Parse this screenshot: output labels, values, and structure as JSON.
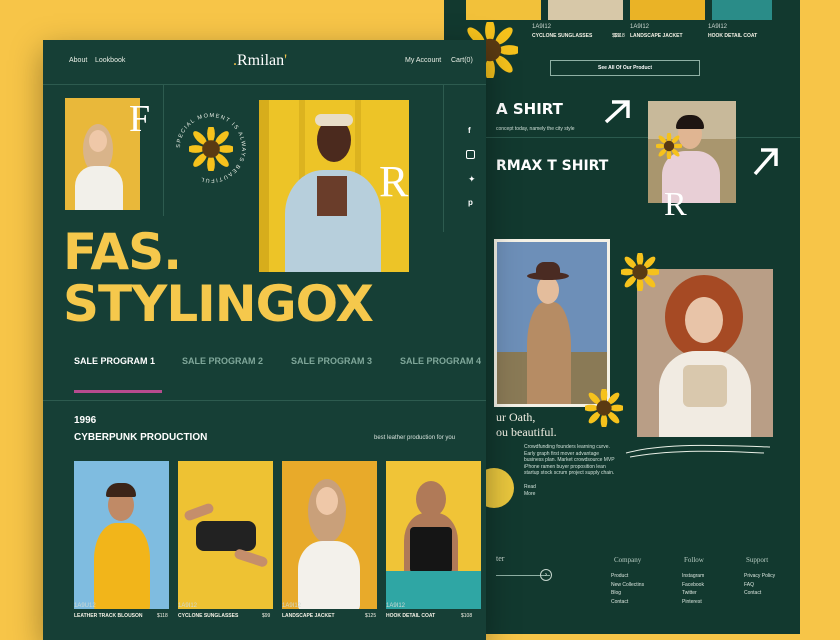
{
  "nav": {
    "about": "About",
    "lookbook": "Lookbook",
    "account": "My Account",
    "cart": "Cart(0)"
  },
  "logo": "Rmilan",
  "letters": {
    "f": "F",
    "r": "R",
    "r2": "R"
  },
  "circle_text": "SPECIAL MOMENT IS ALWAYS BEAUTIFUL",
  "hero": {
    "line1": "FAS.",
    "line2": "STYLINGOX"
  },
  "tabs": [
    "SALE PROGRAM 1",
    "SALE PROGRAM 2",
    "SALE PROGRAM 3",
    "SALE PROGRAM 4"
  ],
  "section": {
    "year": "1996",
    "title": "CYBERPUNK PRODUCTION",
    "tagline": "best leather production for you"
  },
  "products": [
    {
      "code": "1A9U12",
      "name": "LEATHER TRACK BLOUSON",
      "price": "$118"
    },
    {
      "code": "1A9I12",
      "name": "CYCLONE SUNGLASSES",
      "price": "$99"
    },
    {
      "code": "1A9I12",
      "name": "LANDSCAPE JACKET",
      "price": "$125"
    },
    {
      "code": "1A9I12",
      "name": "HOOK DETAIL COAT",
      "price": "$108"
    }
  ],
  "back": {
    "top_products": [
      {
        "code": "1A9I12",
        "name": "CYCLONE SUNGLASSES",
        "price": "$118"
      },
      {
        "code": "1A9I12",
        "name": "LANDSCAPE JACKET",
        "price": "$99"
      },
      {
        "code": "1A9I12",
        "name": "HOOK DETAIL COAT",
        "price": ""
      }
    ],
    "see_all": "See All Of Our Product",
    "headline1": "A SHIRT",
    "sub1": "concept today, namely the city style",
    "headline2": "RMAX T SHIRT",
    "quote1": "ur Oath,",
    "quote2": "ou beautiful.",
    "para": "Crowdfunding founders learning curve. Early graph first mover advantage business plan. Market crowdsource MVP iPhone ramen buyer proposition lean startup stock scrum project supply chain.",
    "read": "Read",
    "more": "More",
    "newsletter": "ter",
    "company": {
      "title": "Company",
      "items": [
        "Product",
        "New Collectins",
        "Blog",
        "Contact"
      ]
    },
    "follow": {
      "title": "Follow",
      "items": [
        "Instagram",
        "Facebook",
        "Twitter",
        "Pinterest"
      ]
    },
    "support": {
      "title": "Support",
      "items": [
        "Privacy Policy",
        "FAQ",
        "Contact"
      ]
    }
  },
  "colors": {
    "bg": "#f7c548",
    "panel": "#163f36",
    "accent": "#f5c84c",
    "underline": "#b64b8e"
  },
  "icons": [
    "facebook-icon",
    "instagram-icon",
    "twitter-icon",
    "pinterest-icon",
    "arrow-up-right-icon",
    "arrow-right-icon",
    "sunflower-icon"
  ]
}
